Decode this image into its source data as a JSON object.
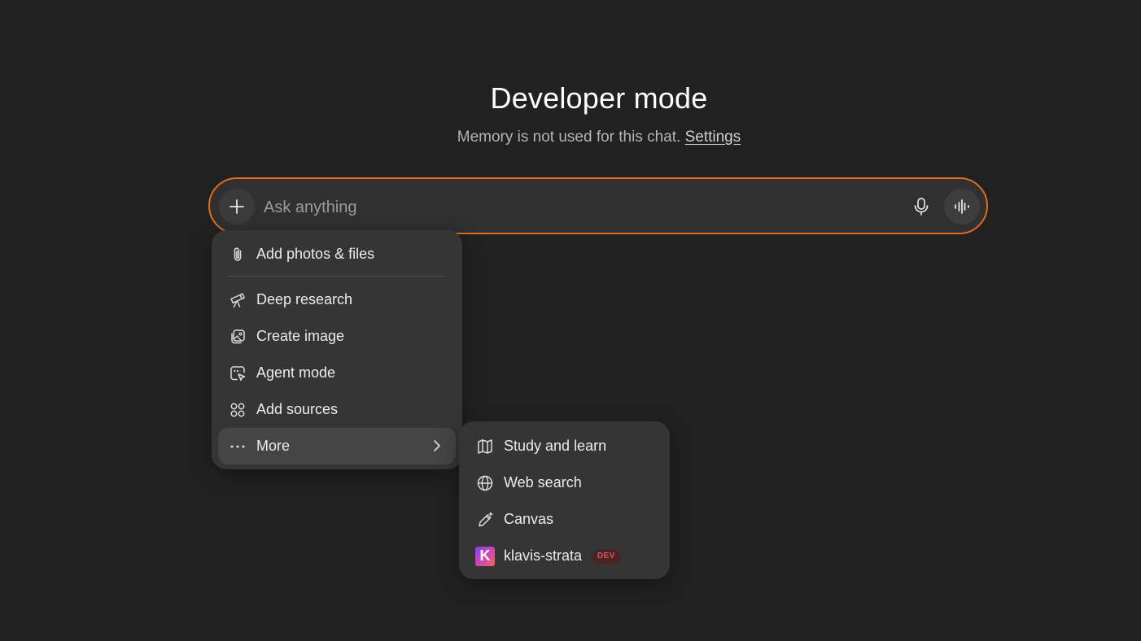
{
  "header": {
    "title": "Developer mode",
    "subtitle_text": "Memory is not used for this chat.",
    "settings_link": "Settings"
  },
  "composer": {
    "placeholder": "Ask anything",
    "accent_color": "#e06c1f"
  },
  "menu": {
    "items": [
      {
        "label": "Add photos & files",
        "icon": "paperclip-icon"
      },
      {
        "label": "Deep research",
        "icon": "telescope-icon"
      },
      {
        "label": "Create image",
        "icon": "image-icon"
      },
      {
        "label": "Agent mode",
        "icon": "agent-cursor-icon"
      },
      {
        "label": "Add sources",
        "icon": "apps-icon"
      },
      {
        "label": "More",
        "icon": "ellipsis-icon"
      }
    ]
  },
  "submenu": {
    "items": [
      {
        "label": "Study and learn",
        "icon": "book-icon"
      },
      {
        "label": "Web search",
        "icon": "globe-icon"
      },
      {
        "label": "Canvas",
        "icon": "pen-sparkle-icon"
      },
      {
        "label": "klavis-strata",
        "icon": "klavis-logo",
        "logo_letter": "K",
        "badge": "DEV"
      }
    ]
  }
}
